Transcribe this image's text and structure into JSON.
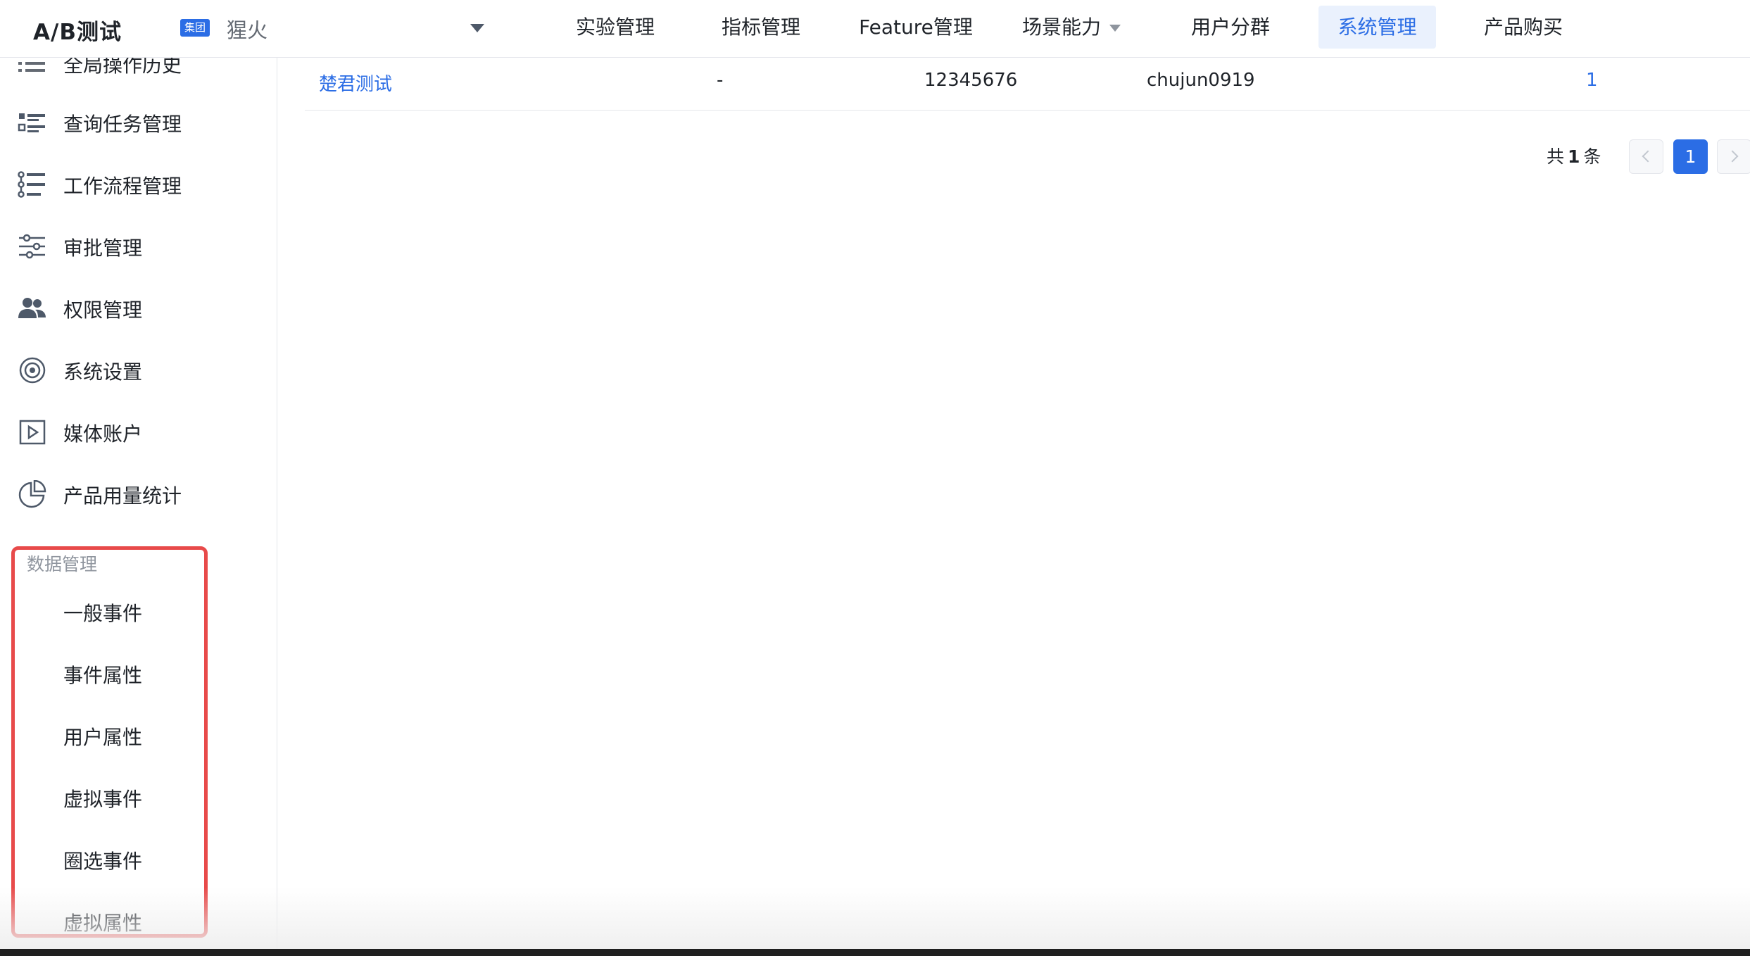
{
  "header": {
    "brand": "A/B测试",
    "group_badge": "集团",
    "project_name": "猩火",
    "nav": [
      {
        "label": "实验管理"
      },
      {
        "label": "指标管理"
      },
      {
        "label": "Feature管理"
      },
      {
        "label": "场景能力"
      },
      {
        "label": "用户分群"
      },
      {
        "label": "系统管理"
      },
      {
        "label": "产品购买"
      }
    ],
    "active_nav": "系统管理"
  },
  "sidebar": {
    "items": [
      {
        "label": "全局操作历史",
        "icon": "list-icon"
      },
      {
        "label": "查询任务管理",
        "icon": "task-list-icon"
      },
      {
        "label": "工作流程管理",
        "icon": "workflow-icon"
      },
      {
        "label": "审批管理",
        "icon": "sliders-icon"
      },
      {
        "label": "权限管理",
        "icon": "users-icon"
      },
      {
        "label": "系统设置",
        "icon": "target-icon"
      },
      {
        "label": "媒体账户",
        "icon": "play-icon"
      },
      {
        "label": "产品用量统计",
        "icon": "pie-chart-icon"
      }
    ],
    "data_section": {
      "title": "数据管理",
      "items": [
        "一般事件",
        "事件属性",
        "用户属性",
        "虚拟事件",
        "圈选事件",
        "虚拟属性"
      ]
    }
  },
  "table": {
    "rows": [
      {
        "name": "楚君测试",
        "col2": "-",
        "col3": "12345676",
        "col4": "chujun0919",
        "col5": "1"
      }
    ]
  },
  "pagination": {
    "total_prefix": "共",
    "total": "1",
    "total_suffix": "条",
    "current_page": "1"
  },
  "colors": {
    "accent": "#2b6de5",
    "highlight": "#e84a4a"
  }
}
